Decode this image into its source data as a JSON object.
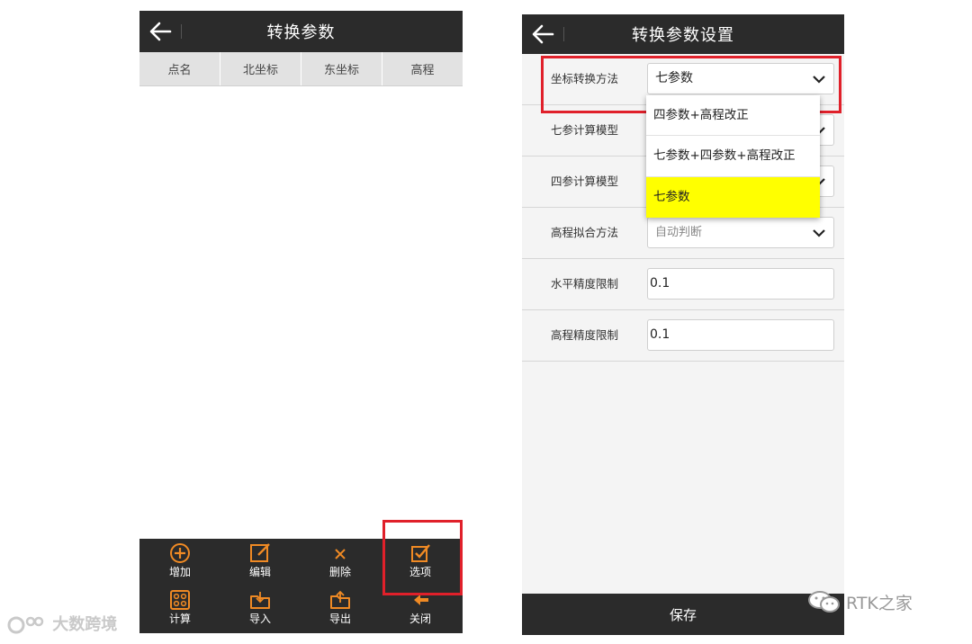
{
  "left_screen": {
    "title": "转换参数",
    "columns": [
      "点名",
      "北坐标",
      "东坐标",
      "高程"
    ],
    "toolbar": {
      "add": "增加",
      "edit": "编辑",
      "delete": "删除",
      "options": "选项",
      "compute": "计算",
      "import": "导入",
      "export": "导出",
      "close": "关闭"
    }
  },
  "right_screen": {
    "title": "转换参数设置",
    "rows": [
      {
        "label": "坐标转换方法",
        "value": "七参数"
      },
      {
        "label": "七参计算模型",
        "value": ""
      },
      {
        "label": "四参计算模型",
        "value": ""
      },
      {
        "label": "高程拟合方法",
        "value": "自动判断"
      },
      {
        "label": "水平精度限制",
        "value": "0.1"
      },
      {
        "label": "高程精度限制",
        "value": "0.1"
      }
    ],
    "dropdown_options": [
      "四参数+高程改正",
      "七参数+四参数+高程改正",
      "七参数"
    ],
    "selected_option": "七参数",
    "save_label": "保存"
  },
  "watermarks": {
    "left": "大数跨境",
    "right": "RTK之家"
  },
  "colors": {
    "bar": "#2b2b2b",
    "icon_accent": "#f08a24",
    "highlight_box": "#e0202a",
    "selected_option": "#ffff00"
  }
}
